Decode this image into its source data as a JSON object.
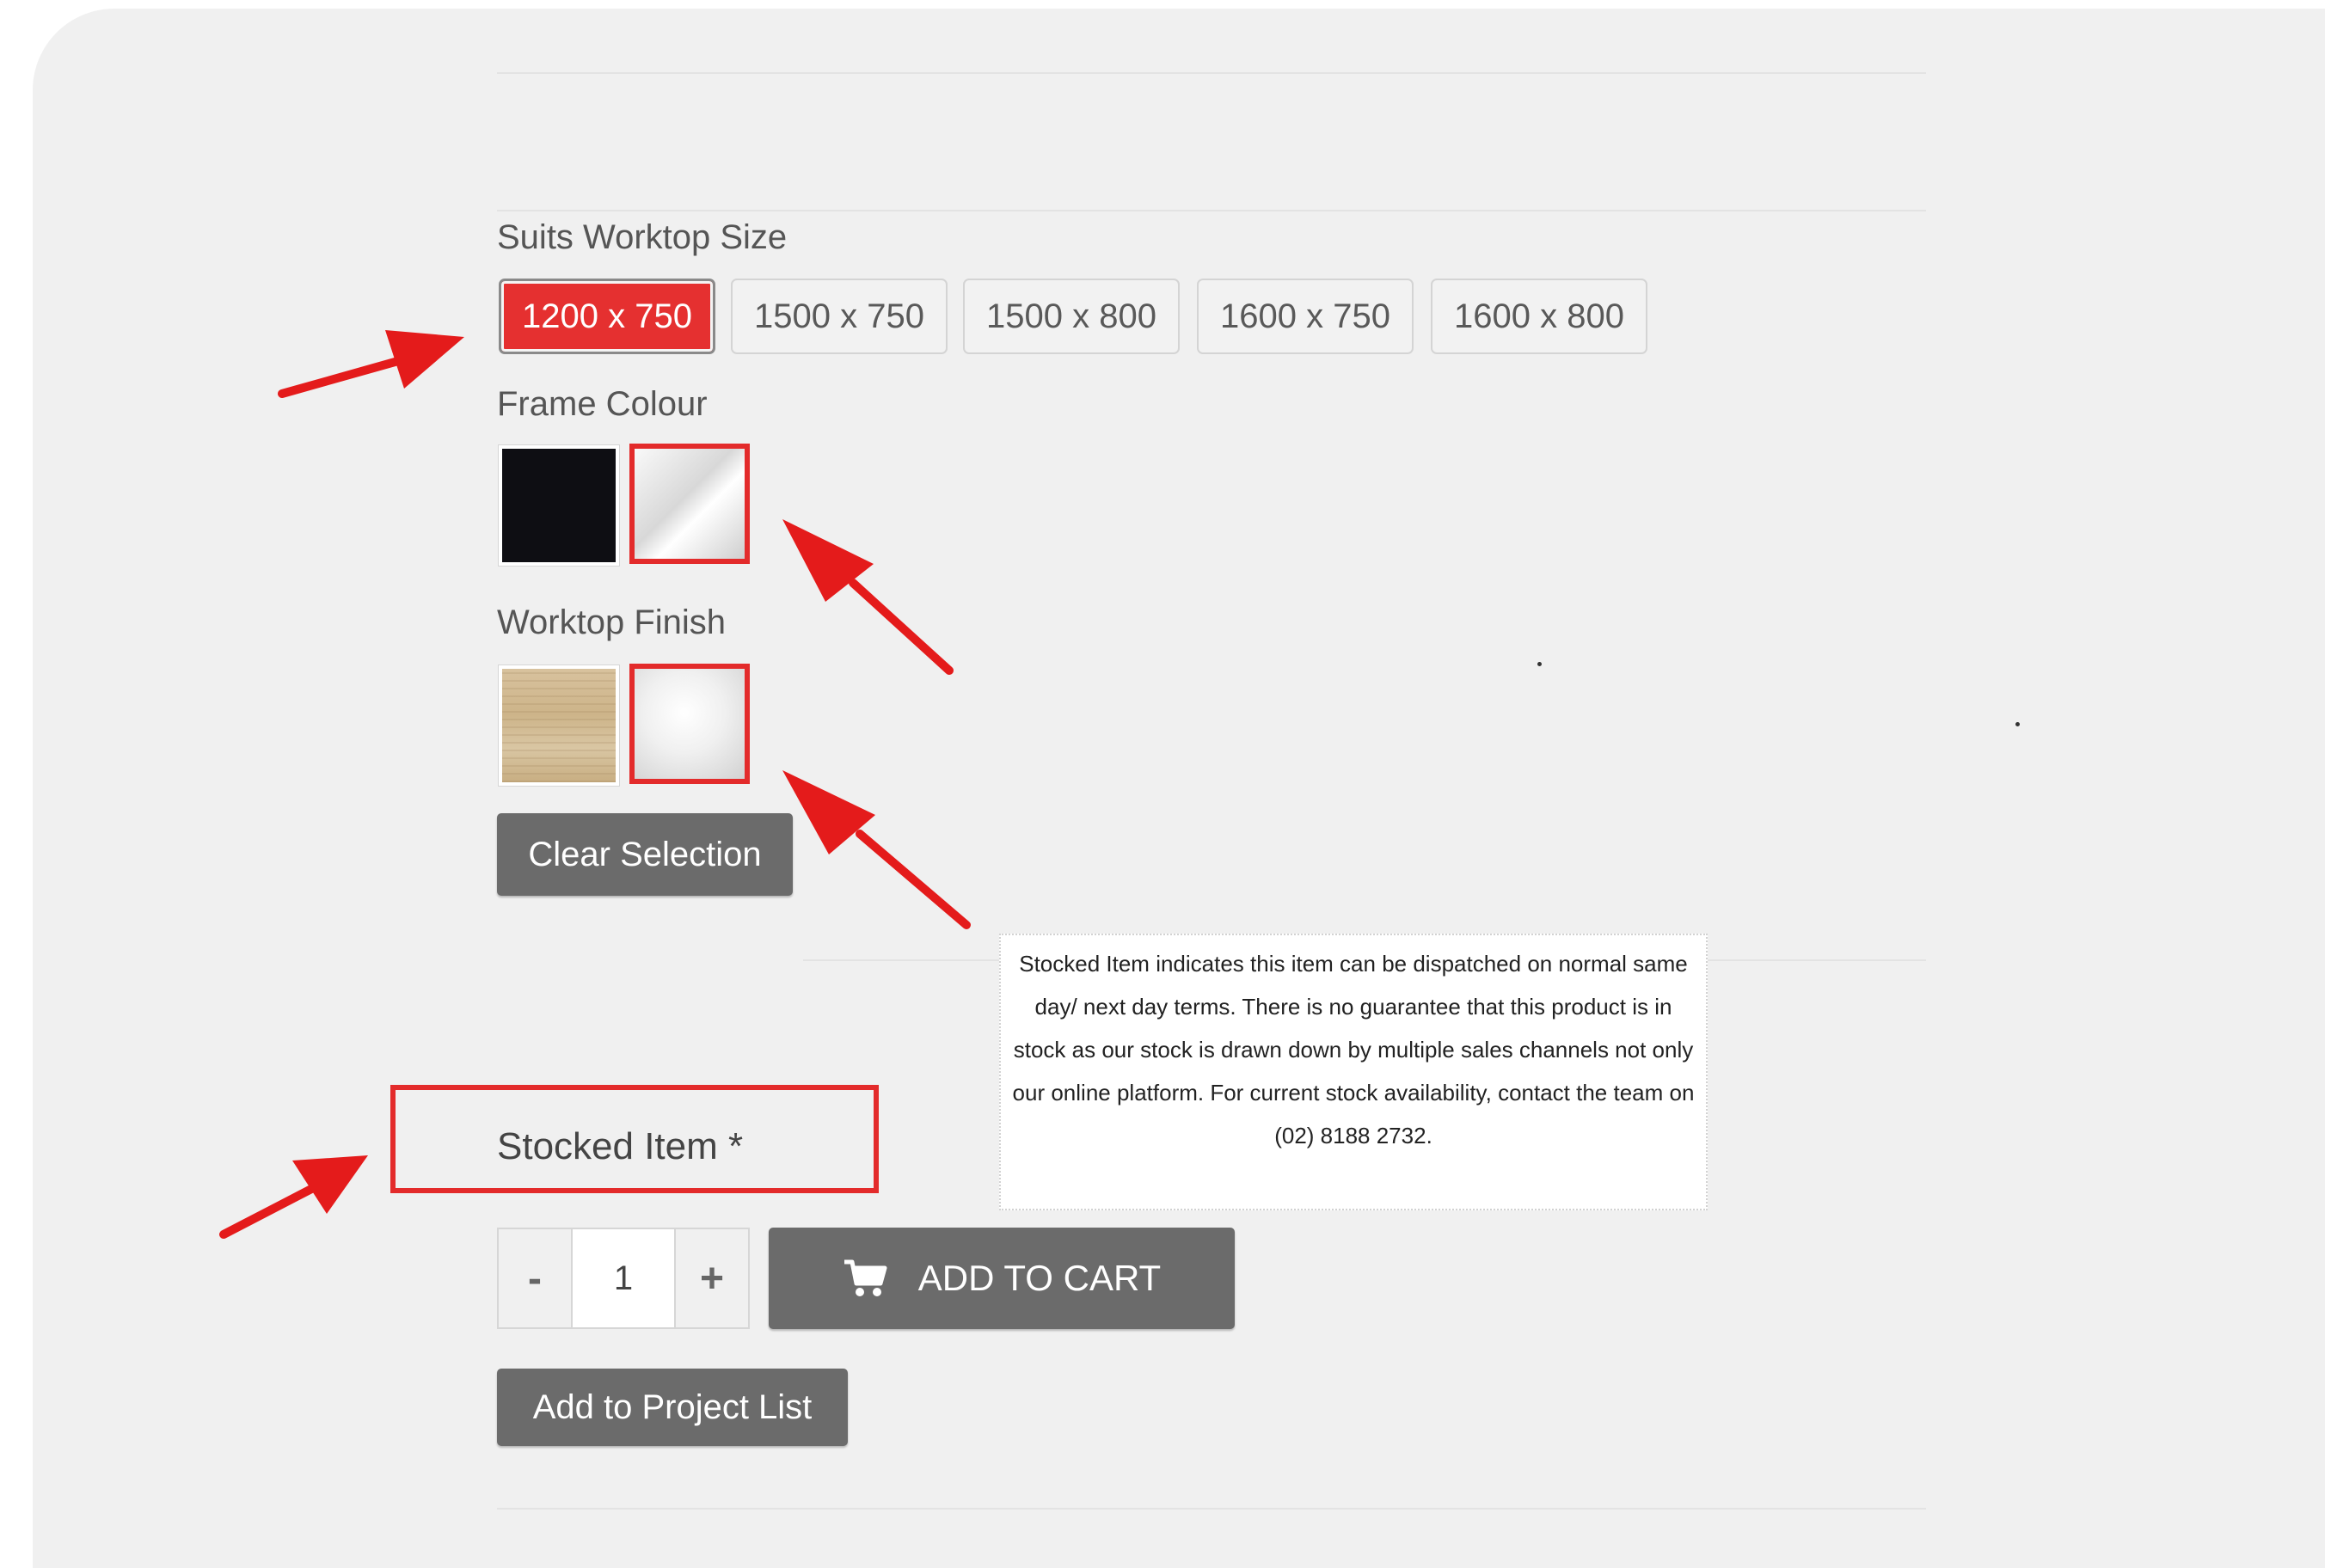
{
  "worktop_size": {
    "label": "Suits Worktop Size",
    "options": [
      "1200 x 750",
      "1500 x 750",
      "1500 x 800",
      "1600 x 750",
      "1600 x 800"
    ],
    "selected": "1200 x 750"
  },
  "frame_colour": {
    "label": "Frame Colour",
    "swatches": [
      "black",
      "white"
    ],
    "selected": "white"
  },
  "worktop_finish": {
    "label": "Worktop Finish",
    "swatches": [
      "oak",
      "white"
    ],
    "selected": "white"
  },
  "clear_selection_label": "Clear Selection",
  "stock": {
    "label": "Stocked Item *",
    "tooltip": "Stocked Item indicates this item can be dispatched on normal same day/ next day terms. There is no guarantee that this product is in stock as our stock is drawn down by multiple sales channels not only our online platform. For current stock availability, contact the team on (02) 8188 2732."
  },
  "quantity": {
    "minus": "-",
    "value": "1",
    "plus": "+"
  },
  "add_to_cart_label": "ADD TO CART",
  "add_to_project_label": "Add to Project List",
  "icons": {
    "cart": "cart-icon",
    "annotation": "red-arrow-icon"
  },
  "colors": {
    "accent_red": "#e53030",
    "button_gray": "#6b6b6b",
    "panel_bg": "#f0f0f0"
  }
}
